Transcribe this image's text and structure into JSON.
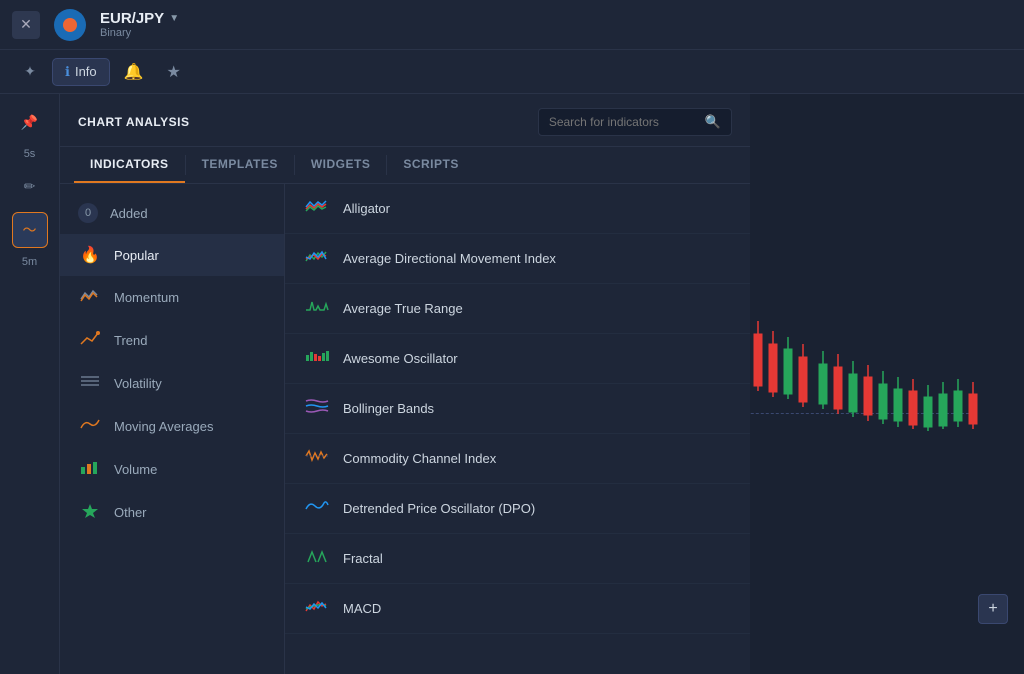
{
  "topbar": {
    "close_label": "✕",
    "instrument_name": "EUR/JPY",
    "instrument_dropdown": "▼",
    "instrument_type": "Binary"
  },
  "secondbar": {
    "pin_icon": "✦",
    "info_label": "Info",
    "info_icon": "ℹ",
    "notif_icon": "🔔",
    "star_icon": "★"
  },
  "panel": {
    "title": "CHART ANALYSIS",
    "search_placeholder": "Search for indicators",
    "tabs": [
      {
        "id": "indicators",
        "label": "INDICATORS",
        "active": true
      },
      {
        "id": "templates",
        "label": "TEMPLATES",
        "active": false
      },
      {
        "id": "widgets",
        "label": "WIDGETS",
        "active": false
      },
      {
        "id": "scripts",
        "label": "SCRIPTS",
        "active": false
      }
    ],
    "categories": [
      {
        "id": "added",
        "label": "Added",
        "icon": "0",
        "badge": true
      },
      {
        "id": "popular",
        "label": "Popular",
        "icon": "🔥",
        "active": true
      },
      {
        "id": "momentum",
        "label": "Momentum",
        "icon": "≋"
      },
      {
        "id": "trend",
        "label": "Trend",
        "icon": "📈"
      },
      {
        "id": "volatility",
        "label": "Volatility",
        "icon": "≈"
      },
      {
        "id": "moving-averages",
        "label": "Moving Averages",
        "icon": "∿"
      },
      {
        "id": "volume",
        "label": "Volume",
        "icon": "📊"
      },
      {
        "id": "other",
        "label": "Other",
        "icon": "▲"
      }
    ],
    "indicators": [
      {
        "id": "alligator",
        "label": "Alligator",
        "icon": "≋"
      },
      {
        "id": "admi",
        "label": "Average Directional Movement Index",
        "icon": "≈"
      },
      {
        "id": "atr",
        "label": "Average True Range",
        "icon": "∧∨"
      },
      {
        "id": "ao",
        "label": "Awesome Oscillator",
        "icon": "📶"
      },
      {
        "id": "bb",
        "label": "Bollinger Bands",
        "icon": "≡"
      },
      {
        "id": "cci",
        "label": "Commodity Channel Index",
        "icon": "⟿"
      },
      {
        "id": "dpo",
        "label": "Detrended Price Oscillator (DPO)",
        "icon": "∿"
      },
      {
        "id": "fractal",
        "label": "Fractal",
        "icon": "∧"
      },
      {
        "id": "macd",
        "label": "MACD",
        "icon": "≋"
      }
    ]
  },
  "sidebar": {
    "items": [
      {
        "id": "lock",
        "label": "",
        "icon": "📌",
        "active": false
      },
      {
        "id": "time-5s",
        "label": "5s",
        "active": false
      },
      {
        "id": "pencil",
        "label": "",
        "icon": "✏",
        "active": false
      },
      {
        "id": "wave",
        "label": "",
        "icon": "〜",
        "active": true
      },
      {
        "id": "time-5m",
        "label": "5m",
        "active": false
      }
    ]
  },
  "chart": {
    "zoom_plus": "+"
  }
}
